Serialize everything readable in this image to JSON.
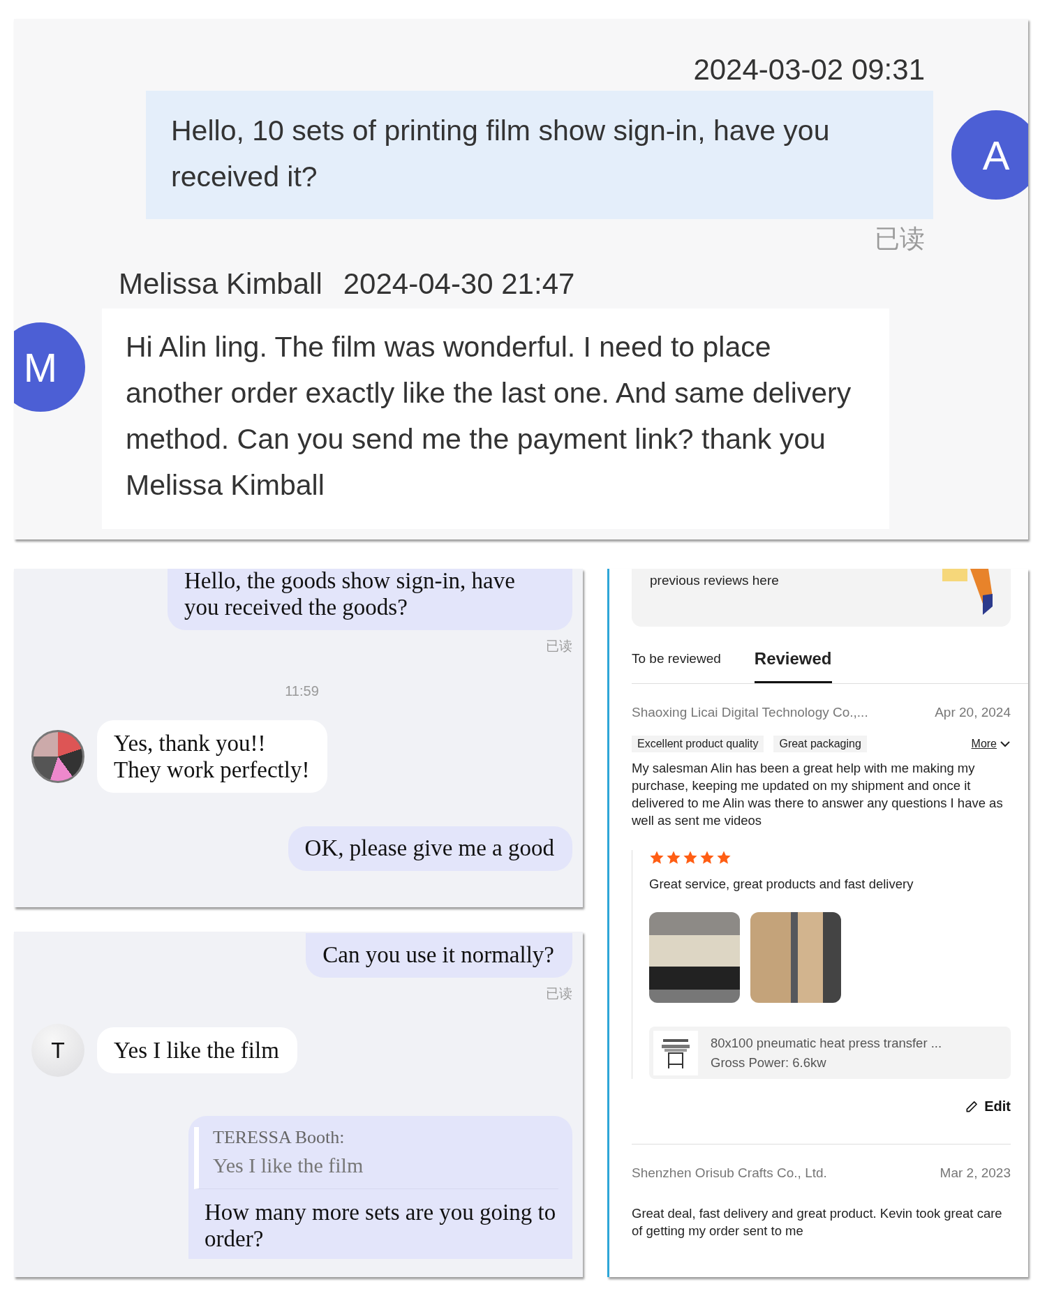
{
  "top_chat": {
    "outgoing": {
      "time": "2024-03-02 09:31",
      "text": "Hello, 10 sets of printing film show sign-in, have you received it?",
      "avatar": "A",
      "status": "已读"
    },
    "incoming": {
      "name": "Melissa Kimball",
      "time": "2024-04-30 21:47",
      "avatar": "M",
      "text": "Hi Alin ling. The film was wonderful. I need to place another order exactly like the last one. And same delivery method. Can you send me the payment link? thank you Melissa Kimball"
    }
  },
  "chat_1": {
    "messages": [
      {
        "kind": "outgoing",
        "text": "Hello, the goods show sign-in, have you received the goods?",
        "status": "已读"
      },
      {
        "kind": "time",
        "text": "11:59"
      },
      {
        "kind": "incoming",
        "text": "Yes, thank you!!\nThey work perfectly!"
      },
      {
        "kind": "outgoing",
        "text": "OK, please give me a good"
      }
    ]
  },
  "chat_2": {
    "messages": [
      {
        "kind": "outgoing",
        "text": "Can you use it normally?",
        "status": "已读"
      },
      {
        "kind": "incoming",
        "avatar": "T",
        "text": "Yes I like the film"
      },
      {
        "kind": "reply",
        "quote_author": "TERESSA  Booth:",
        "quote_text": "Yes I like the film",
        "text": "How many more sets are you going to order?"
      }
    ]
  },
  "reviews_panel": {
    "banner": {
      "text": "previous reviews  here"
    },
    "tabs": [
      {
        "label": "To be reviewed",
        "selected": false
      },
      {
        "label": "Reviewed",
        "selected": true
      }
    ],
    "reviews": [
      {
        "store": "Shaoxing Licai Digital Technology Co.,...",
        "date": "Apr 20, 2024",
        "tags": [
          "Excellent product quality",
          "Great packaging"
        ],
        "more": "More",
        "text": "My salesman Alin has been a great help with me making my purchase, keeping me updated on my shipment and once it delivered to me Alin was there to answer any questions I have as well as sent me videos",
        "followup": {
          "stars": 5,
          "text": "Great service, great products and fast delivery",
          "product": {
            "title": "80x100 pneumatic heat press transfer ...",
            "spec": "Gross Power: 6.6kw"
          }
        },
        "edit": "Edit"
      },
      {
        "store": "Shenzhen Orisub Crafts Co., Ltd.",
        "date": "Mar 2, 2023",
        "text": "Great deal, fast delivery and great product. Kevin took great care of getting my order sent to me"
      }
    ]
  }
}
